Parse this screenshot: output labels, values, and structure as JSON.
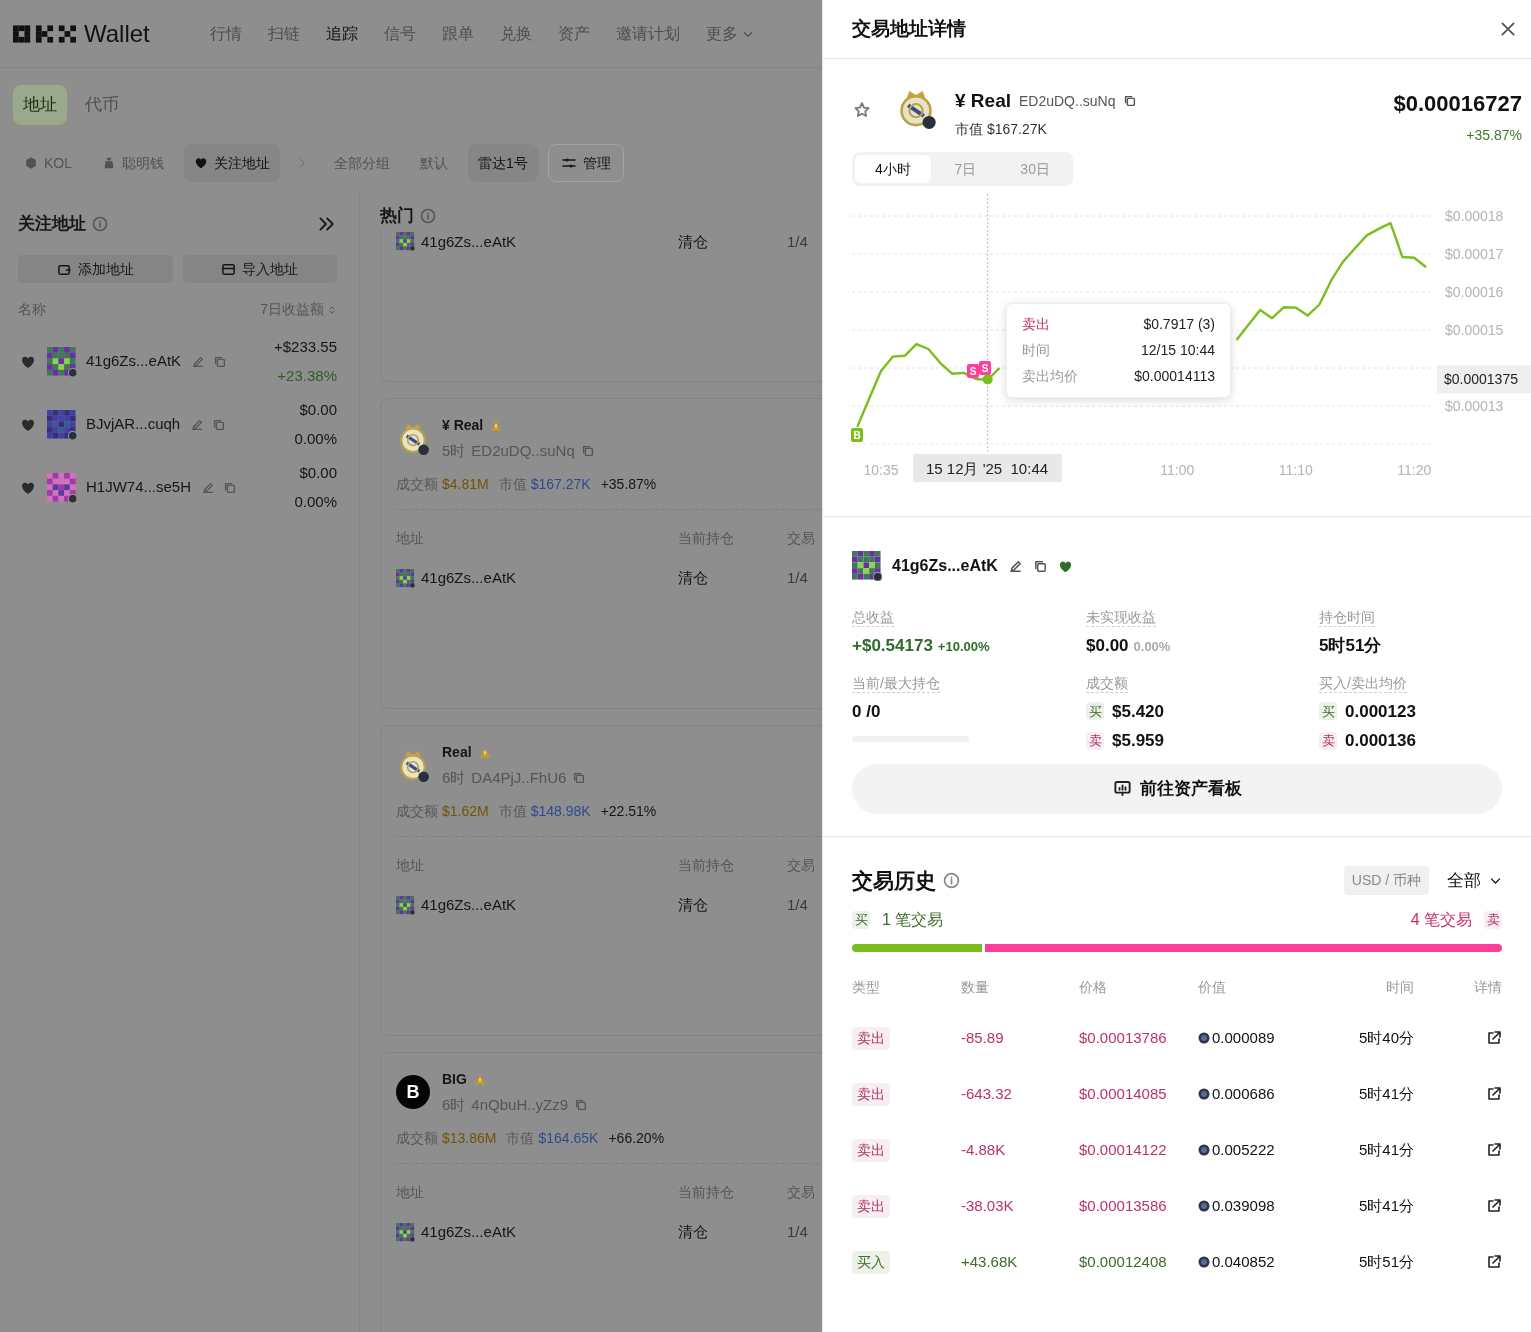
{
  "nav": {
    "brand": "Wallet",
    "items": [
      {
        "label": "行情",
        "selected": false,
        "has_menu": false
      },
      {
        "label": "扫链",
        "selected": false,
        "has_menu": false
      },
      {
        "label": "追踪",
        "selected": true,
        "has_menu": false
      },
      {
        "label": "信号",
        "selected": false,
        "has_menu": false
      },
      {
        "label": "跟单",
        "selected": false,
        "has_menu": false
      },
      {
        "label": "兑换",
        "selected": false,
        "has_menu": false
      },
      {
        "label": "资产",
        "selected": false,
        "has_menu": false
      },
      {
        "label": "邀请计划",
        "selected": false,
        "has_menu": false
      },
      {
        "label": "更多",
        "selected": false,
        "has_menu": true
      }
    ]
  },
  "view_tabs": [
    {
      "label": "地址",
      "selected": true
    },
    {
      "label": "代币",
      "selected": false
    }
  ],
  "filters": {
    "categories": [
      {
        "label": "KOL",
        "kind": "badge",
        "selected": false
      },
      {
        "label": "聪明钱",
        "kind": "bag",
        "selected": false
      },
      {
        "label": "关注地址",
        "kind": "heart",
        "selected": true
      }
    ],
    "groups": [
      {
        "label": "全部分组",
        "selected": false
      },
      {
        "label": "默认",
        "selected": false
      },
      {
        "label": "雷达1号",
        "selected": true
      }
    ],
    "manage_button": "管理"
  },
  "sidebar": {
    "title": "关注地址",
    "add_button": "添加地址",
    "import_button": "导入地址",
    "columns": [
      "名称",
      "7日收益额"
    ],
    "wallets": [
      {
        "address": "41g6Zs...eAtK",
        "pnl": "+$233.55",
        "pct": "+23.38%",
        "positive": true
      },
      {
        "address": "BJvjAR...cuqh",
        "pnl": "$0.00",
        "pct": "0.00%",
        "positive": false
      },
      {
        "address": "H1JW74...se5H",
        "pnl": "$0.00",
        "pct": "0.00%",
        "positive": false
      }
    ]
  },
  "hot": {
    "title": "热门",
    "cards": [
      {
        "kind": "partial",
        "rows": [
          {
            "address": "41g6Zs...eAtK",
            "position": "清仓",
            "trades": "1/4"
          }
        ]
      },
      {
        "kind": "full",
        "name": "¥ Real",
        "warning": true,
        "age": "5时",
        "address": "ED2uDQ..suNq",
        "volume_label": "成交额",
        "volume": "$4.81M",
        "mcap_label": "市值",
        "mcap": "$167.27K",
        "change": "+35.87%",
        "columns": [
          "地址",
          "当前持仓",
          "交易"
        ],
        "rows": [
          {
            "address": "41g6Zs...eAtK",
            "position": "清仓",
            "trades": "1/4"
          }
        ]
      },
      {
        "kind": "full",
        "name": "Real",
        "warning": true,
        "age": "6时",
        "address": "DA4PjJ..FhU6",
        "volume_label": "成交额",
        "volume": "$1.62M",
        "mcap_label": "市值",
        "mcap": "$148.98K",
        "change": "+22.51%",
        "columns": [
          "地址",
          "当前持仓",
          "交易"
        ],
        "rows": [
          {
            "address": "41g6Zs...eAtK",
            "position": "清仓",
            "trades": "1/4"
          }
        ]
      },
      {
        "kind": "full",
        "logo_text": "B",
        "name": "BIG",
        "warning": true,
        "age": "6时",
        "address": "4nQbuH..yZz9",
        "volume_label": "成交额",
        "volume": "$13.86M",
        "mcap_label": "市值",
        "mcap": "$164.65K",
        "change": "+66.20%",
        "columns": [
          "地址",
          "当前持仓",
          "交易"
        ],
        "rows": [
          {
            "address": "41g6Zs...eAtK",
            "position": "清仓",
            "trades": "1/4"
          }
        ]
      }
    ]
  },
  "detail": {
    "title": "交易地址详情",
    "token": {
      "name": "¥ Real",
      "address": "ED2uDQ..suNq",
      "mcap": "市值 $167.27K",
      "price": "$0.00016727",
      "change": "+35.87%",
      "starred": false
    },
    "periods": [
      {
        "label": "4小时",
        "selected": true
      },
      {
        "label": "7日",
        "selected": false
      },
      {
        "label": "30日",
        "selected": false
      }
    ],
    "chart_data": {
      "type": "line",
      "categories": [
        null,
        null,
        "10:35",
        null,
        null,
        null,
        null,
        null,
        null,
        null,
        null,
        null,
        null,
        null,
        null,
        null,
        null,
        null,
        null,
        null,
        null,
        null,
        null,
        null,
        null,
        null,
        null,
        "11:00",
        null,
        null,
        null,
        null,
        null,
        null,
        null,
        null,
        null,
        "11:10",
        null,
        null,
        null,
        null,
        null,
        null,
        null,
        null,
        null,
        "11:20",
        null
      ],
      "series": [
        {
          "color": "#7cbd1e",
          "values": [
            0.0001245,
            0.0001319,
            0.0001392,
            0.000143,
            0.0001432,
            0.0001463,
            0.000145,
            0.0001413,
            0.0001385,
            0.0001387,
            0.0001371,
            0.0001369,
            0.00014,
            null,
            null,
            null,
            null,
            null,
            null,
            null,
            null,
            null,
            null,
            null,
            null,
            null,
            null,
            null,
            null,
            null,
            null,
            null,
            0.0001474,
            0.0001513,
            0.0001553,
            0.0001531,
            0.000156,
            0.0001559,
            0.0001538,
            0.0001567,
            0.0001631,
            0.000168,
            0.0001715,
            0.0001749,
            0.0001766,
            0.0001781,
            0.0001692,
            0.000169,
            0.0001665
          ]
        }
      ],
      "grid": true,
      "ylim": [
        0.00012,
        0.00018
      ],
      "yticks": [
        {
          "value": 0.00018,
          "label": "$0.00018"
        },
        {
          "value": 0.00017,
          "label": "$0.00017"
        },
        {
          "value": 0.00016,
          "label": "$0.00016"
        },
        {
          "value": 0.00015,
          "label": "$0.00015"
        },
        {
          "value": 0.00013,
          "label": "$0.00013"
        }
      ],
      "annotations": [
        "$0.0001375",
        "15 12月 '25  10:44",
        "B",
        "S",
        "S"
      ]
    },
    "tooltip": [
      {
        "label": "卖出",
        "value": "$0.7917 (3)",
        "kind": "side"
      },
      {
        "label": "时间",
        "value": "12/15 10:44",
        "kind": "plain"
      },
      {
        "label": "卖出均价",
        "value": "$0.00014113",
        "kind": "plain"
      }
    ],
    "wallet": {
      "address": "41g6Zs...eAtK",
      "followed": true
    },
    "stats": [
      {
        "kind": "value_pct",
        "label": "总收益",
        "value": "+$0.54173",
        "pct": "+10.00%",
        "positive": true
      },
      {
        "kind": "value_pct",
        "label": "未实现收益",
        "value": "$0.00",
        "pct": "0.00%",
        "positive": false
      },
      {
        "kind": "value",
        "label": "持仓时间",
        "value": "5时51分"
      },
      {
        "kind": "bar",
        "label": "当前/最大持仓",
        "value": "0 /0",
        "level": 0
      },
      {
        "kind": "pair",
        "label": "成交额",
        "buy_tag": "买",
        "buy": "$5.420",
        "sell_tag": "卖",
        "sell": "$5.959"
      },
      {
        "kind": "pair",
        "label": "买入/卖出均价",
        "buy_tag": "买",
        "buy": "0.000123",
        "sell_tag": "卖",
        "sell": "0.000136"
      }
    ],
    "dashboard_button": "前往资产看板"
  },
  "history": {
    "title": "交易历史",
    "unit_toggle": "USD / 币种",
    "filter": "全部",
    "buy_tag": "买",
    "buy_count": "1 笔交易",
    "sell_count": "4 笔交易",
    "sell_tag": "卖",
    "level": 0.2,
    "columns": [
      "类型",
      "数量",
      "价格",
      "价值",
      "时间",
      "详情"
    ],
    "rows": [
      {
        "kind": "sell",
        "type": "卖出",
        "amount": "-85.89",
        "price": "$0.00013786",
        "value": "0.000089",
        "time": "5时40分"
      },
      {
        "kind": "sell",
        "type": "卖出",
        "amount": "-643.32",
        "price": "$0.00014085",
        "value": "0.000686",
        "time": "5时41分"
      },
      {
        "kind": "sell",
        "type": "卖出",
        "amount": "-4.88K",
        "price": "$0.00014122",
        "value": "0.005222",
        "time": "5时41分"
      },
      {
        "kind": "sell",
        "type": "卖出",
        "amount": "-38.03K",
        "price": "$0.00013586",
        "value": "0.039098",
        "time": "5时41分"
      },
      {
        "kind": "buy",
        "type": "买入",
        "amount": "+43.68K",
        "price": "$0.00012408",
        "value": "0.040852",
        "time": "5时51分"
      }
    ]
  }
}
